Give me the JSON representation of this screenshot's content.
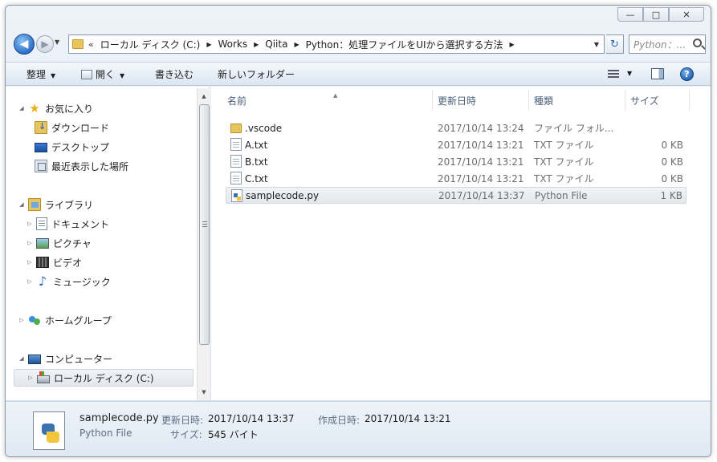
{
  "window": {
    "minimize": "—",
    "maximize": "□",
    "close": "✕"
  },
  "address": {
    "overflow": "«",
    "crumbs": [
      "ローカル ディスク (C:)",
      "Works",
      "Qiita",
      "Python：処理ファイルをUIから選択する方法"
    ],
    "search_placeholder": "Python：...",
    "back": "◀",
    "forward": "▶"
  },
  "toolbar": {
    "organize": "整理",
    "open": "開く",
    "burn": "書き込む",
    "new_folder": "新しいフォルダー",
    "help": "?"
  },
  "sidebar": {
    "favorites": {
      "label": "お気に入り",
      "items": [
        "ダウンロード",
        "デスクトップ",
        "最近表示した場所"
      ]
    },
    "libraries": {
      "label": "ライブラリ",
      "items": [
        "ドキュメント",
        "ピクチャ",
        "ビデオ",
        "ミュージック"
      ]
    },
    "homegroup": "ホームグループ",
    "computer": {
      "label": "コンピューター",
      "items": [
        "ローカル ディスク (C:)"
      ]
    }
  },
  "columns": {
    "name": "名前",
    "date": "更新日時",
    "type": "種類",
    "size": "サイズ"
  },
  "files": [
    {
      "name": ".vscode",
      "date": "2017/10/14 13:24",
      "type": "ファイル フォル...",
      "size": "",
      "icon": "folder-icon"
    },
    {
      "name": "A.txt",
      "date": "2017/10/14 13:21",
      "type": "TXT ファイル",
      "size": "0 KB",
      "icon": "text-file-icon"
    },
    {
      "name": "B.txt",
      "date": "2017/10/14 13:21",
      "type": "TXT ファイル",
      "size": "0 KB",
      "icon": "text-file-icon"
    },
    {
      "name": "C.txt",
      "date": "2017/10/14 13:21",
      "type": "TXT ファイル",
      "size": "0 KB",
      "icon": "text-file-icon"
    },
    {
      "name": "samplecode.py",
      "date": "2017/10/14 13:37",
      "type": "Python File",
      "size": "1 KB",
      "icon": "python-file-icon"
    }
  ],
  "details": {
    "name": "samplecode.py",
    "type": "Python File",
    "modified_label": "更新日時:",
    "modified_value": "2017/10/14 13:37",
    "created_label": "作成日時:",
    "created_value": "2017/10/14 13:21",
    "size_label": "サイズ:",
    "size_value": "545 バイト"
  },
  "colors": {
    "accent": "#2a70c8",
    "folder": "#e8c45c",
    "header_text": "#4c607a"
  }
}
